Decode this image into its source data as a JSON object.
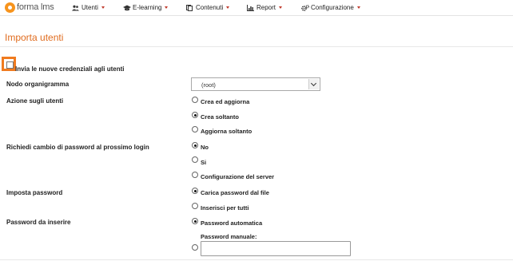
{
  "brand": {
    "logo_text_a": "forma",
    "logo_text_b": "lms"
  },
  "nav": [
    {
      "label": "Utenti",
      "icon": "users-icon"
    },
    {
      "label": "E-learning",
      "icon": "graduation-cap-icon"
    },
    {
      "label": "Contenuti",
      "icon": "files-icon"
    },
    {
      "label": "Report",
      "icon": "bar-chart-icon"
    },
    {
      "label": "Configurazione",
      "icon": "gears-icon"
    }
  ],
  "page": {
    "title": "Importa utenti"
  },
  "form": {
    "send_credentials": {
      "label": "Invia le nuove credenziali agli utenti",
      "checked": false
    },
    "org_node": {
      "label": "Nodo organigramma",
      "value": "(root)"
    },
    "user_action": {
      "label": "Azione sugli utenti",
      "options": [
        "Crea ed aggiorna",
        "Crea soltanto",
        "Aggiorna soltanto"
      ],
      "selected": "Crea soltanto"
    },
    "pwd_change": {
      "label": "Richiedi cambio di password al prossimo login",
      "options": [
        "No",
        "Si",
        "Configurazione del server"
      ],
      "selected": "No"
    },
    "set_password": {
      "label": "Imposta password",
      "options": [
        "Carica password dal file",
        "Inserisci per tutti"
      ],
      "selected": "Carica password dal file"
    },
    "password_type": {
      "label": "Password da inserire",
      "options": [
        "Password automatica",
        "Password manuale:"
      ],
      "selected": "Password automatica",
      "manual_value": ""
    }
  },
  "colors": {
    "accent": "#e06c1f",
    "highlight": "#f07b1f",
    "caret": "#c0392b"
  }
}
